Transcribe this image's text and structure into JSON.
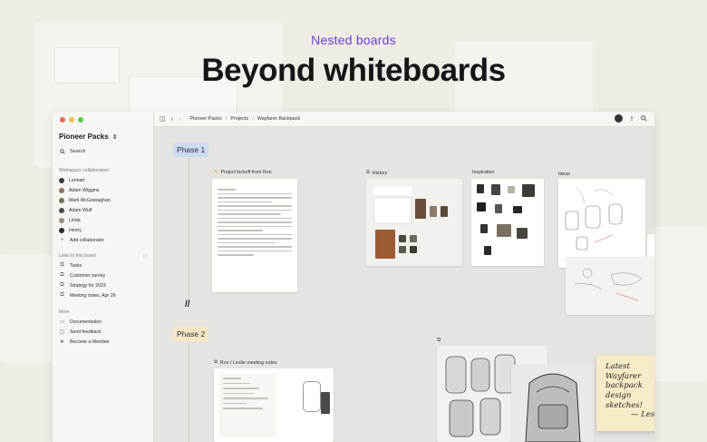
{
  "hero": {
    "eyebrow": "Nested boards",
    "headline": "Beyond whiteboards"
  },
  "colors": {
    "accent": "#6b3fd4",
    "phase1_bg": "#cfdaf0",
    "phase2_bg": "#f6e8c4",
    "sticky_bg": "#f6ecc8"
  },
  "sidebar": {
    "workspace": "Pioneer Packs",
    "search_label": "Search",
    "collaborators_heading": "Workspace collaborators",
    "collaborators": [
      {
        "name": "Lennart"
      },
      {
        "name": "Adam Wiggins"
      },
      {
        "name": "Mark McGranaghan"
      },
      {
        "name": "Adam Wulf"
      },
      {
        "name": "Linda"
      },
      {
        "name": "Henry"
      }
    ],
    "add_collaborator": "Add collaborator",
    "links_heading": "Links to this board",
    "links": [
      {
        "label": "Tasks"
      },
      {
        "label": "Customer survey"
      },
      {
        "label": "Strategy for 2023"
      },
      {
        "label": "Meeting notes, Apr 26"
      }
    ],
    "more_heading": "More",
    "more": [
      {
        "label": "Documentation",
        "icon": "book-icon"
      },
      {
        "label": "Send feedback",
        "icon": "feedback-icon"
      },
      {
        "label": "Become a Member",
        "icon": "member-icon"
      }
    ]
  },
  "toolbar": {
    "breadcrumbs": [
      "Pioneer Packs",
      "Projects",
      "Wayfarer Backpack"
    ]
  },
  "canvas": {
    "phase1_label": "Phase 1",
    "phase2_label": "Phase 2",
    "cards": {
      "kickoff_title": "Project kickoff from Ron",
      "history_title": "History",
      "inspiration_title": "Inspiration",
      "ideas_title": "Ideas",
      "meeting_title": "Ron / Leslie meeting notes"
    },
    "slash": "//",
    "sticky": {
      "lines": [
        "Latest Wayfarer",
        "backpack",
        "design sketches!"
      ],
      "signature": "— Leslie"
    }
  }
}
